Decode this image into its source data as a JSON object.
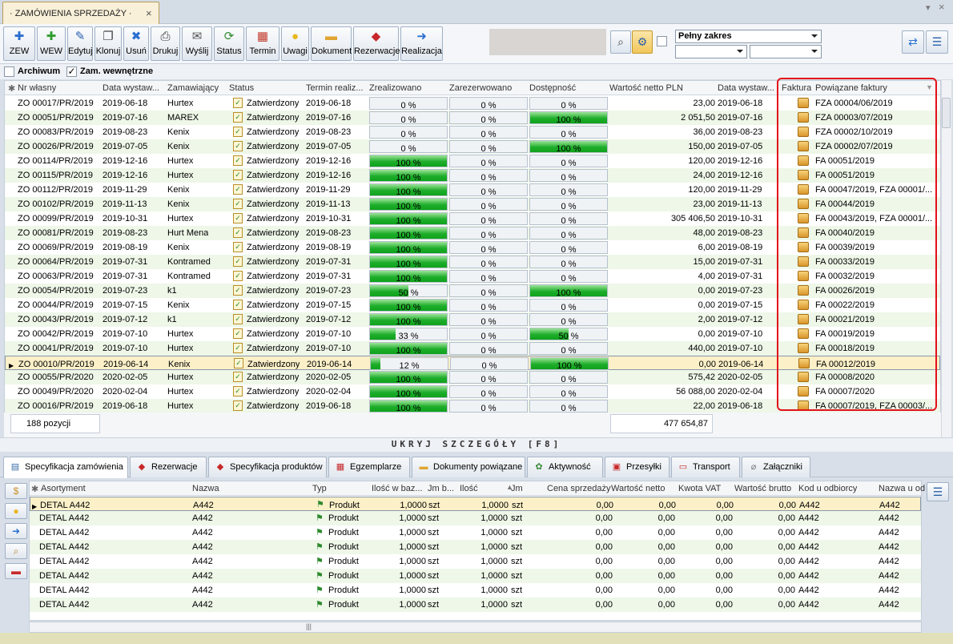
{
  "tab": {
    "title": "· ZAMÓWIENIA SPRZEDAŻY ·",
    "close": "×"
  },
  "window": {
    "pin": "▾",
    "close": "×"
  },
  "toolbar": [
    {
      "name": "zew-button",
      "icon": "plus-icon",
      "glyph": "✚",
      "color": "#2a6fd0",
      "label": "ZEW"
    },
    {
      "name": "wew-button",
      "icon": "plus-green-icon",
      "glyph": "✚",
      "color": "#2f9d2f",
      "label": "WEW"
    },
    {
      "name": "edit-button",
      "icon": "pencil-icon",
      "glyph": "✎",
      "color": "#2a5fb0",
      "label": "Edytuj"
    },
    {
      "name": "clone-button",
      "icon": "copy-icon",
      "glyph": "❐",
      "color": "#444",
      "label": "Klonuj"
    },
    {
      "name": "delete-button",
      "icon": "x-icon",
      "glyph": "✖",
      "color": "#2a6fd0",
      "label": "Usuń"
    },
    {
      "name": "print-button",
      "icon": "printer-icon",
      "glyph": "⎙",
      "color": "#333",
      "label": "Drukuj"
    },
    {
      "name": "send-button",
      "icon": "mail-icon",
      "glyph": "✉",
      "color": "#555",
      "label": "Wyślij"
    },
    {
      "name": "status-button",
      "icon": "refresh-icon",
      "glyph": "⟳",
      "color": "#2f8a2f",
      "label": "Status"
    },
    {
      "name": "deadline-button",
      "icon": "calendar-icon",
      "glyph": "▦",
      "color": "#c23a2a",
      "label": "Termin"
    },
    {
      "name": "notes-button",
      "icon": "bulb-icon",
      "glyph": "●",
      "color": "#e8b820",
      "label": "Uwagi"
    },
    {
      "name": "document-button",
      "icon": "folder-icon",
      "glyph": "▬",
      "color": "#e0a430",
      "label": "Dokument"
    },
    {
      "name": "reservation-button",
      "icon": "reservation-icon",
      "glyph": "◆",
      "color": "#c8282a",
      "label": "Rezerwacje"
    },
    {
      "name": "realization-button",
      "icon": "arrow-icon",
      "glyph": "➜",
      "color": "#2a6fd0",
      "label": "Realizacja"
    }
  ],
  "filters": {
    "range": "Pełny zakres",
    "select2": "",
    "select3": ""
  },
  "checks": {
    "archive_label": "Archiwum",
    "internal_label": "Zam. wewnętrzne"
  },
  "grid": {
    "headers": [
      "Nr własny",
      "Data wystaw...",
      "Zamawiający",
      "Status",
      "Termin realiz...",
      "Zrealizowano",
      "Zarezerwowano",
      "Dostępność",
      "Wartość netto PLN",
      "Data wystaw...",
      "Faktura",
      "Powiązane faktury"
    ],
    "rows": [
      [
        "ZO 00017/PR/2019",
        "2019-06-18",
        "Hurtex",
        "Zatwierdzony",
        "2019-06-18",
        "0 %",
        "0 %",
        "0 %",
        "23,00",
        "2019-06-18",
        "FZA 00004/06/2019"
      ],
      [
        "ZO 00051/PR/2019",
        "2019-07-16",
        "MAREX",
        "Zatwierdzony",
        "2019-07-16",
        "0 %",
        "0 %",
        "100 %",
        "2 051,50",
        "2019-07-16",
        "FZA 00003/07/2019"
      ],
      [
        "ZO 00083/PR/2019",
        "2019-08-23",
        "Kenix",
        "Zatwierdzony",
        "2019-08-23",
        "0 %",
        "0 %",
        "0 %",
        "36,00",
        "2019-08-23",
        "FZA 00002/10/2019"
      ],
      [
        "ZO 00026/PR/2019",
        "2019-07-05",
        "Kenix",
        "Zatwierdzony",
        "2019-07-05",
        "0 %",
        "0 %",
        "100 %",
        "150,00",
        "2019-07-05",
        "FZA 00002/07/2019"
      ],
      [
        "ZO 00114/PR/2019",
        "2019-12-16",
        "Hurtex",
        "Zatwierdzony",
        "2019-12-16",
        "100 %",
        "0 %",
        "0 %",
        "120,00",
        "2019-12-16",
        "FA 00051/2019"
      ],
      [
        "ZO 00115/PR/2019",
        "2019-12-16",
        "Hurtex",
        "Zatwierdzony",
        "2019-12-16",
        "100 %",
        "0 %",
        "0 %",
        "24,00",
        "2019-12-16",
        "FA 00051/2019"
      ],
      [
        "ZO 00112/PR/2019",
        "2019-11-29",
        "Kenix",
        "Zatwierdzony",
        "2019-11-29",
        "100 %",
        "0 %",
        "0 %",
        "120,00",
        "2019-11-29",
        "FA 00047/2019, FZA 00001/..."
      ],
      [
        "ZO 00102/PR/2019",
        "2019-11-13",
        "Kenix",
        "Zatwierdzony",
        "2019-11-13",
        "100 %",
        "0 %",
        "0 %",
        "23,00",
        "2019-11-13",
        "FA 00044/2019"
      ],
      [
        "ZO 00099/PR/2019",
        "2019-10-31",
        "Hurtex",
        "Zatwierdzony",
        "2019-10-31",
        "100 %",
        "0 %",
        "0 %",
        "305 406,50",
        "2019-10-31",
        "FA 00043/2019, FZA 00001/..."
      ],
      [
        "ZO 00081/PR/2019",
        "2019-08-23",
        "Hurt Mena",
        "Zatwierdzony",
        "2019-08-23",
        "100 %",
        "0 %",
        "0 %",
        "48,00",
        "2019-08-23",
        "FA 00040/2019"
      ],
      [
        "ZO 00069/PR/2019",
        "2019-08-19",
        "Kenix",
        "Zatwierdzony",
        "2019-08-19",
        "100 %",
        "0 %",
        "0 %",
        "6,00",
        "2019-08-19",
        "FA 00039/2019"
      ],
      [
        "ZO 00064/PR/2019",
        "2019-07-31",
        "Kontramed",
        "Zatwierdzony",
        "2019-07-31",
        "100 %",
        "0 %",
        "0 %",
        "15,00",
        "2019-07-31",
        "FA 00033/2019"
      ],
      [
        "ZO 00063/PR/2019",
        "2019-07-31",
        "Kontramed",
        "Zatwierdzony",
        "2019-07-31",
        "100 %",
        "0 %",
        "0 %",
        "4,00",
        "2019-07-31",
        "FA 00032/2019"
      ],
      [
        "ZO 00054/PR/2019",
        "2019-07-23",
        "k1",
        "Zatwierdzony",
        "2019-07-23",
        "50 %",
        "0 %",
        "100 %",
        "0,00",
        "2019-07-23",
        "FA 00026/2019"
      ],
      [
        "ZO 00044/PR/2019",
        "2019-07-15",
        "Kenix",
        "Zatwierdzony",
        "2019-07-15",
        "100 %",
        "0 %",
        "0 %",
        "0,00",
        "2019-07-15",
        "FA 00022/2019"
      ],
      [
        "ZO 00043/PR/2019",
        "2019-07-12",
        "k1",
        "Zatwierdzony",
        "2019-07-12",
        "100 %",
        "0 %",
        "0 %",
        "2,00",
        "2019-07-12",
        "FA 00021/2019"
      ],
      [
        "ZO 00042/PR/2019",
        "2019-07-10",
        "Hurtex",
        "Zatwierdzony",
        "2019-07-10",
        "33 %",
        "0 %",
        "50 %",
        "0,00",
        "2019-07-10",
        "FA 00019/2019"
      ],
      [
        "ZO 00041/PR/2019",
        "2019-07-10",
        "Hurtex",
        "Zatwierdzony",
        "2019-07-10",
        "100 %",
        "0 %",
        "0 %",
        "440,00",
        "2019-07-10",
        "FA 00018/2019"
      ],
      [
        "ZO 00010/PR/2019",
        "2019-06-14",
        "Kenix",
        "Zatwierdzony",
        "2019-06-14",
        "12 %",
        "0 %",
        "100 %",
        "0,00",
        "2019-06-14",
        "FA 00012/2019"
      ],
      [
        "ZO 00055/PR/2020",
        "2020-02-05",
        "Hurtex",
        "Zatwierdzony",
        "2020-02-05",
        "100 %",
        "0 %",
        "0 %",
        "575,42",
        "2020-02-05",
        "FA 00008/2020"
      ],
      [
        "ZO 00049/PR/2020",
        "2020-02-04",
        "Hurtex",
        "Zatwierdzony",
        "2020-02-04",
        "100 %",
        "0 %",
        "0 %",
        "56 088,00",
        "2020-02-04",
        "FA 00007/2020"
      ],
      [
        "ZO 00016/PR/2019",
        "2019-06-18",
        "Hurtex",
        "Zatwierdzony",
        "2019-06-18",
        "100 %",
        "0 %",
        "0 %",
        "22,00",
        "2019-06-18",
        "FA 00007/2019, FZA 00003/..."
      ]
    ],
    "progress": {
      "zrealizowano": [
        0,
        0,
        0,
        0,
        1,
        1,
        1,
        1,
        1,
        1,
        1,
        1,
        1,
        0.5,
        1,
        1,
        0.33,
        1,
        0.12,
        1,
        1,
        1
      ],
      "dostepnosc": [
        0,
        1,
        0,
        1,
        0,
        0,
        0,
        0,
        0,
        0,
        0,
        0,
        0,
        1,
        0,
        0,
        0.5,
        0,
        1,
        0,
        0,
        0
      ]
    },
    "selected_row": 18
  },
  "footer": {
    "count": "188 pozycji",
    "total": "477 654,87"
  },
  "details_toggle": "UKRYJ SZCZEGÓŁY [F8]",
  "detail_tabs": [
    {
      "name": "tab-order-specification",
      "icon": "doc-icon",
      "glyph": "▤",
      "color": "#3b6ea8",
      "label": "Specyfikacja zamówienia"
    },
    {
      "name": "tab-reservations",
      "icon": "reservation-icon",
      "glyph": "◆",
      "color": "#c8282a",
      "label": "Rezerwacje"
    },
    {
      "name": "tab-product-specification",
      "icon": "products-icon",
      "glyph": "◆",
      "color": "#c8282a",
      "label": "Specyfikacja produktów"
    },
    {
      "name": "tab-copies",
      "icon": "copies-icon",
      "glyph": "▦",
      "color": "#c8282a",
      "label": "Egzemplarze"
    },
    {
      "name": "tab-related-documents",
      "icon": "folder-icon",
      "glyph": "▬",
      "color": "#e0a430",
      "label": "Dokumenty powiązane"
    },
    {
      "name": "tab-activity",
      "icon": "activity-icon",
      "glyph": "✿",
      "color": "#3a8a3a",
      "label": "Aktywność"
    },
    {
      "name": "tab-shipments",
      "icon": "package-icon",
      "glyph": "▣",
      "color": "#c8282a",
      "label": "Przesyłki"
    },
    {
      "name": "tab-transport",
      "icon": "truck-icon",
      "glyph": "▭",
      "color": "#c8282a",
      "label": "Transport"
    },
    {
      "name": "tab-attachments",
      "icon": "paperclip-icon",
      "glyph": "⌀",
      "color": "#777",
      "label": "Załączniki"
    }
  ],
  "detail_grid": {
    "headers": [
      "Asortyment",
      "Nazwa",
      "Typ",
      "Ilość w baz...",
      "Jm b...",
      "Ilość",
      "Jm",
      "Cena sprzedaży",
      "Wartość netto",
      "Kwota VAT",
      "Wartość brutto",
      "Kod u odbiorcy",
      "Nazwa u od"
    ],
    "rows": [
      [
        "DETAL A442",
        "A442",
        "Produkt",
        "1,0000",
        "szt",
        "1,0000",
        "szt",
        "0,00",
        "0,00",
        "0,00",
        "0,00",
        "A442",
        "A442"
      ],
      [
        "DETAL A442",
        "A442",
        "Produkt",
        "1,0000",
        "szt",
        "1,0000",
        "szt",
        "0,00",
        "0,00",
        "0,00",
        "0,00",
        "A442",
        "A442"
      ],
      [
        "DETAL A442",
        "A442",
        "Produkt",
        "1,0000",
        "szt",
        "1,0000",
        "szt",
        "0,00",
        "0,00",
        "0,00",
        "0,00",
        "A442",
        "A442"
      ],
      [
        "DETAL A442",
        "A442",
        "Produkt",
        "1,0000",
        "szt",
        "1,0000",
        "szt",
        "0,00",
        "0,00",
        "0,00",
        "0,00",
        "A442",
        "A442"
      ],
      [
        "DETAL A442",
        "A442",
        "Produkt",
        "1,0000",
        "szt",
        "1,0000",
        "szt",
        "0,00",
        "0,00",
        "0,00",
        "0,00",
        "A442",
        "A442"
      ],
      [
        "DETAL A442",
        "A442",
        "Produkt",
        "1,0000",
        "szt",
        "1,0000",
        "szt",
        "0,00",
        "0,00",
        "0,00",
        "0,00",
        "A442",
        "A442"
      ],
      [
        "DETAL A442",
        "A442",
        "Produkt",
        "1,0000",
        "szt",
        "1,0000",
        "szt",
        "0,00",
        "0,00",
        "0,00",
        "0,00",
        "A442",
        "A442"
      ],
      [
        "DETAL A442",
        "A442",
        "Produkt",
        "1,0000",
        "szt",
        "1,0000",
        "szt",
        "0,00",
        "0,00",
        "0,00",
        "0,00",
        "A442",
        "A442"
      ]
    ]
  },
  "side_buttons": [
    {
      "name": "money-button",
      "icon": "coins-icon",
      "glyph": "$",
      "color": "#c8902a"
    },
    {
      "name": "bulb-button",
      "icon": "bulb-icon",
      "glyph": "●",
      "color": "#e8b820"
    },
    {
      "name": "realization-side-button",
      "icon": "arrow-icon",
      "glyph": "➜",
      "color": "#2a6fd0"
    },
    {
      "name": "search-side-button",
      "icon": "magnifier-icon",
      "glyph": "⌕",
      "color": "#b07a20"
    },
    {
      "name": "card-side-button",
      "icon": "card-icon",
      "glyph": "▬",
      "color": "#c8282a"
    }
  ],
  "hscroll_grip": "|||"
}
